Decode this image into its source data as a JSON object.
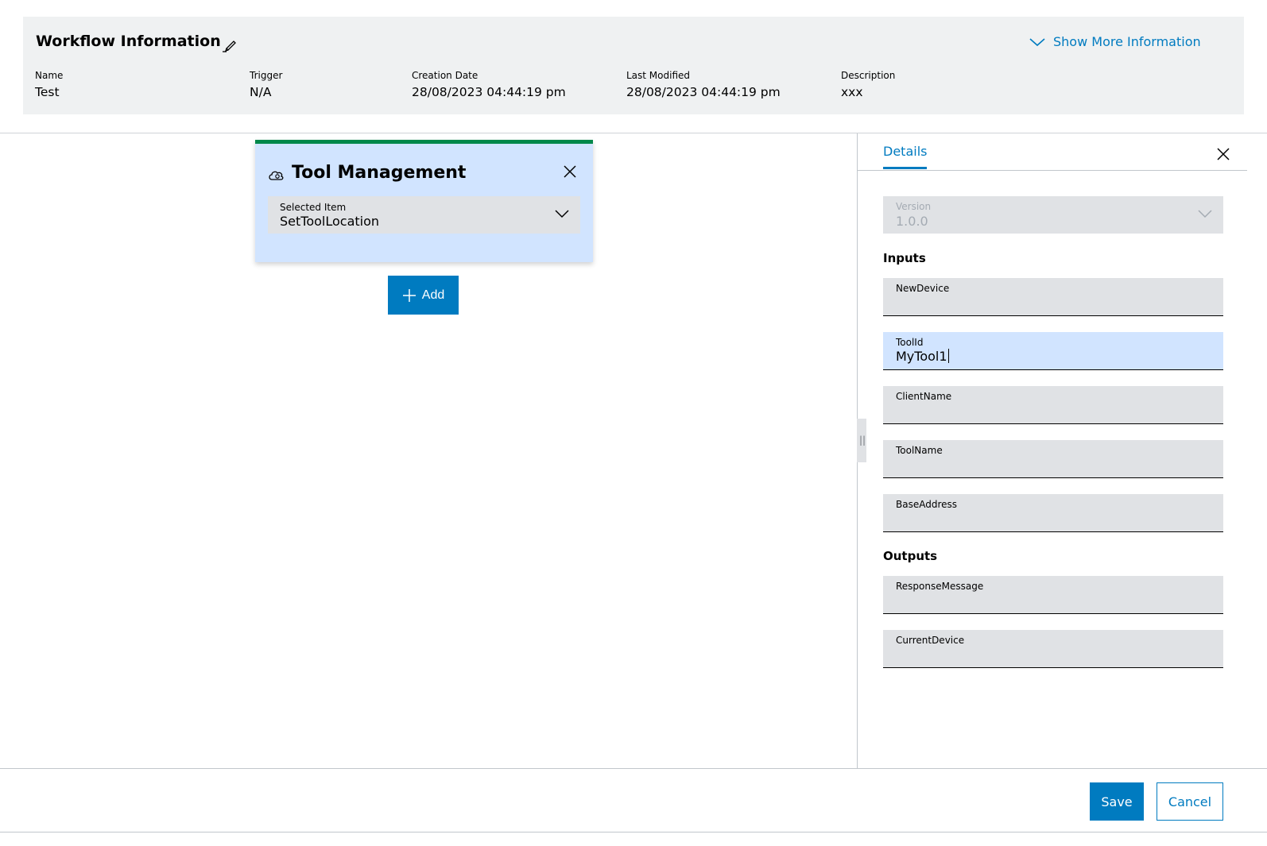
{
  "workflow_info": {
    "title": "Workflow Information",
    "show_more_label": "Show More Information",
    "fields": [
      {
        "label": "Name",
        "value": "Test"
      },
      {
        "label": "Trigger",
        "value": "N/A"
      },
      {
        "label": "Creation Date",
        "value": "28/08/2023 04:44:19 pm"
      },
      {
        "label": "Last Modified",
        "value": "28/08/2023 04:44:19 pm"
      },
      {
        "label": "Description",
        "value": "xxx"
      }
    ]
  },
  "card": {
    "title": "Tool Management",
    "select_label": "Selected Item",
    "select_value": "SetToolLocation",
    "accent_color": "#00884a"
  },
  "add_label": "Add",
  "details": {
    "tab_label": "Details",
    "version_label": "Version",
    "version_value": "1.0.0",
    "inputs_heading": "Inputs",
    "inputs": [
      {
        "label": "NewDevice",
        "value": ""
      },
      {
        "label": "ToolId",
        "value": "MyTool1"
      },
      {
        "label": "ClientName",
        "value": ""
      },
      {
        "label": "ToolName",
        "value": ""
      },
      {
        "label": "BaseAddress",
        "value": ""
      }
    ],
    "outputs_heading": "Outputs",
    "outputs": [
      {
        "label": "ResponseMessage",
        "value": ""
      },
      {
        "label": "CurrentDevice",
        "value": ""
      }
    ]
  },
  "footer": {
    "save_label": "Save",
    "cancel_label": "Cancel"
  },
  "colors": {
    "primary": "#007bc0",
    "focused_field": "#d1e4ff",
    "header_bg": "#eff1f2"
  }
}
